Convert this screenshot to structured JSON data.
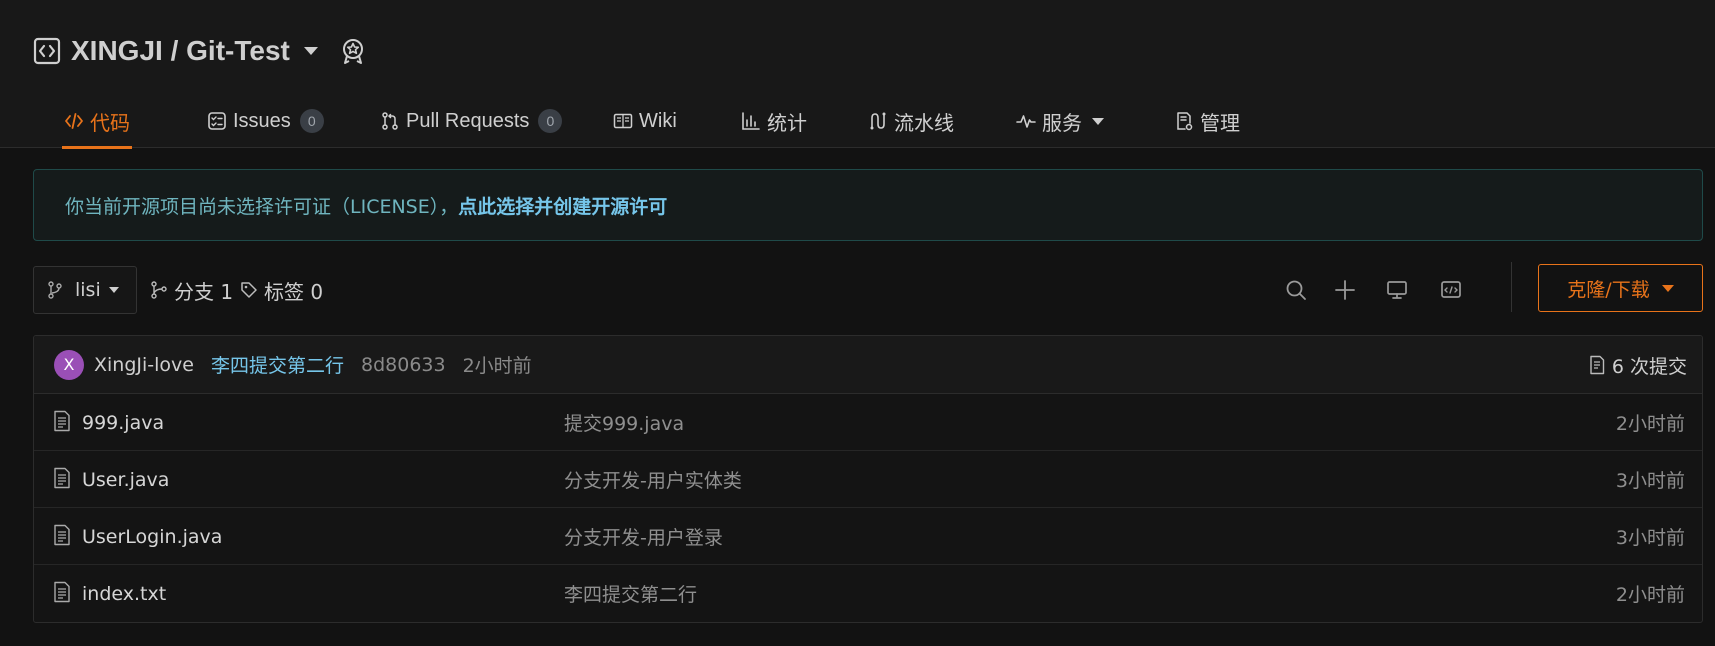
{
  "repo": {
    "title": "XINGJI / Git-Test",
    "icon": "code-bracket-icon",
    "badge_icon": "award-badge-icon"
  },
  "nav": {
    "tabs": [
      {
        "label": "代码",
        "icon": "code-icon",
        "active": true
      },
      {
        "label": "Issues",
        "icon": "issues-icon",
        "count": "0"
      },
      {
        "label": "Pull Requests",
        "icon": "pull-request-icon",
        "count": "0"
      },
      {
        "label": "Wiki",
        "icon": "wiki-book-icon"
      },
      {
        "label": "统计",
        "icon": "bar-chart-icon"
      },
      {
        "label": "流水线",
        "icon": "pipeline-icon"
      },
      {
        "label": "服务",
        "icon": "pulse-icon"
      },
      {
        "label": "管理",
        "icon": "settings-doc-icon"
      }
    ]
  },
  "license_notice": {
    "text": "你当前开源项目尚未选择许可证（LICENSE），",
    "link": "点此选择并创建开源许可"
  },
  "toolbar": {
    "branch": "lisi",
    "branches_label": "分支 1",
    "tags_label": "标签 0",
    "tools": [
      "search-icon",
      "plus-icon",
      "monitor-icon",
      "web-ide-icon"
    ],
    "clone_label": "克隆/下载"
  },
  "latest_commit": {
    "avatar_letter": "X",
    "author": "XingJi-love",
    "message": "李四提交第二行",
    "sha": "8d80633",
    "time": "2小时前",
    "commit_count": "6 次提交"
  },
  "files": [
    {
      "name": "999.java",
      "message": "提交999.java",
      "time": "2小时前"
    },
    {
      "name": "User.java",
      "message": "分支开发-用户实体类",
      "time": "3小时前"
    },
    {
      "name": "UserLogin.java",
      "message": "分支开发-用户登录",
      "time": "3小时前"
    },
    {
      "name": "index.txt",
      "message": "李四提交第二行",
      "time": "2小时前"
    }
  ],
  "colors": {
    "accent": "#e8731a",
    "link": "#76c6ea",
    "background": "#121212"
  }
}
